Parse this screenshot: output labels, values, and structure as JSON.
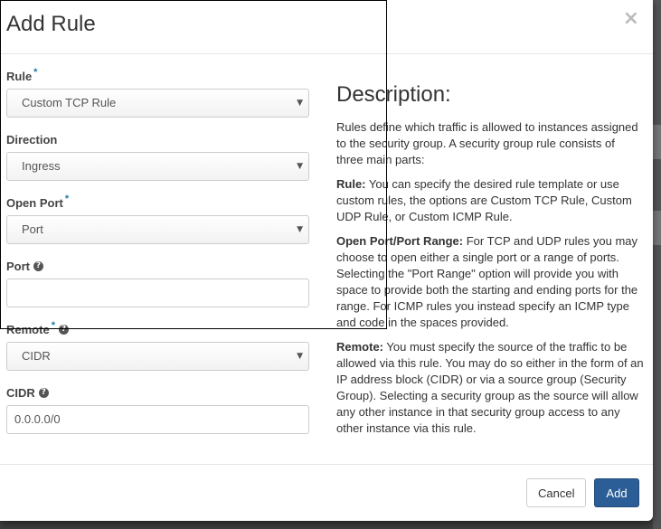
{
  "modal": {
    "title": "Add Rule",
    "close_glyph": "×"
  },
  "form": {
    "required_marker": "*",
    "help_glyph": "?",
    "fields": {
      "rule": {
        "label": "Rule",
        "value": "Custom TCP Rule"
      },
      "direction": {
        "label": "Direction",
        "value": "Ingress"
      },
      "open_port": {
        "label": "Open Port",
        "value": "Port"
      },
      "port": {
        "label": "Port",
        "value": ""
      },
      "remote": {
        "label": "Remote",
        "value": "CIDR"
      },
      "cidr": {
        "label": "CIDR",
        "value": "0.0.0.0/0"
      }
    },
    "caret_glyph": "▼"
  },
  "description": {
    "heading": "Description:",
    "intro": "Rules define which traffic is allowed to instances assigned to the security group. A security group rule consists of three main parts:",
    "rule_term": "Rule:",
    "rule_text": " You can specify the desired rule template or use custom rules, the options are Custom TCP Rule, Custom UDP Rule, or Custom ICMP Rule.",
    "port_term": "Open Port/Port Range:",
    "port_text": " For TCP and UDP rules you may choose to open either a single port or a range of ports. Selecting the \"Port Range\" option will provide you with space to provide both the starting and ending ports for the range. For ICMP rules you instead specify an ICMP type and code in the spaces provided.",
    "remote_term": "Remote:",
    "remote_text": " You must specify the source of the traffic to be allowed via this rule. You may do so either in the form of an IP address block (CIDR) or via a source group (Security Group). Selecting a security group as the source will allow any other instance in that security group access to any other instance via this rule."
  },
  "footer": {
    "cancel_label": "Cancel",
    "add_label": "Add"
  },
  "colors": {
    "primary": "#2b5e96",
    "required": "#2277aa"
  }
}
